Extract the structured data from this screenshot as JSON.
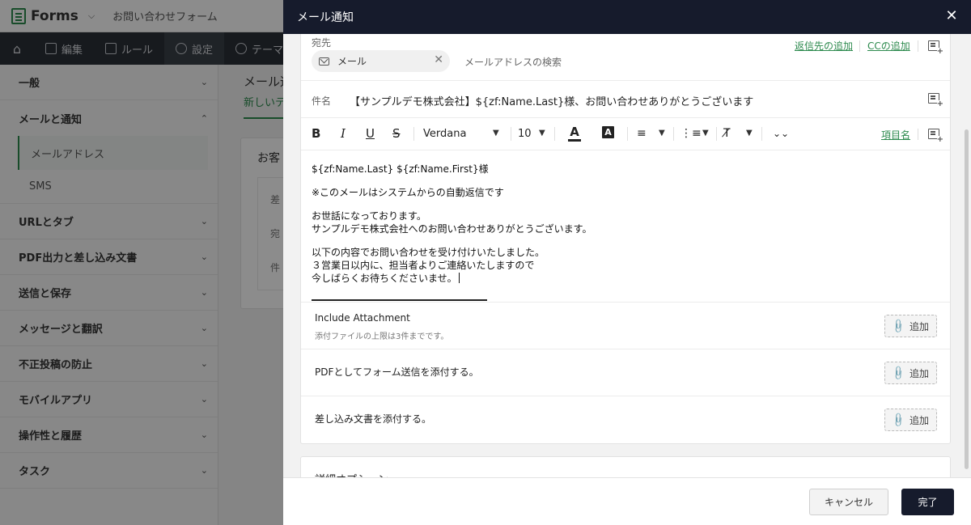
{
  "app": {
    "name": "Forms",
    "form_name": "お問い合わせフォーム",
    "nav": [
      "編集",
      "ルール",
      "設定",
      "テーマ"
    ]
  },
  "sidebar": {
    "sections": [
      {
        "label": "一般"
      },
      {
        "label": "メールと通知",
        "expanded": true,
        "items": [
          "メールアドレス",
          "SMS"
        ]
      },
      {
        "label": "URLとタブ"
      },
      {
        "label": "PDF出力と差し込み文書"
      },
      {
        "label": "送信と保存"
      },
      {
        "label": "メッセージと翻訳"
      },
      {
        "label": "不正投稿の防止"
      },
      {
        "label": "モバイルアプリ"
      },
      {
        "label": "操作性と履歴"
      },
      {
        "label": "タスク"
      }
    ]
  },
  "main_bg": {
    "title": "メール通",
    "tab": "新しいテ",
    "card_title": "お客",
    "card_rows": [
      "差",
      "宛",
      "件"
    ]
  },
  "modal": {
    "title": "メール通知",
    "to": {
      "label": "宛先",
      "chip": "メール",
      "search_placeholder": "メールアドレスの検索",
      "reply_link": "返信先の追加",
      "cc_link": "CCの追加"
    },
    "subject": {
      "label": "件名",
      "value": "【サンプルデモ株式会社】${zf:Name.Last}様、お問い合わせありがとうございます"
    },
    "toolbar": {
      "font": "Verdana",
      "size": "10",
      "field_link": "項目名"
    },
    "body_lines": [
      "${zf:Name.Last} ${zf:Name.First}様",
      "※このメールはシステムからの自動返信です",
      "お世話になっております。",
      "サンプルデモ株式会社へのお問い合わせありがとうございます。",
      "以下の内容でお問い合わせを受け付けいたしました。",
      "３営業日以内に、担当者よりご連絡いたしますので",
      "今しばらくお待ちくださいませ。"
    ],
    "attachments": [
      {
        "title": "Include Attachment",
        "note": "添付ファイルの上限は3件までです。",
        "button": "追加"
      },
      {
        "title": "PDFとしてフォーム送信を添付する。",
        "button": "追加"
      },
      {
        "title": "差し込み文書を添付する。",
        "button": "追加"
      }
    ],
    "detail_options": "詳細オプション",
    "cancel_label": "キャンセル",
    "done_label": "完了"
  }
}
